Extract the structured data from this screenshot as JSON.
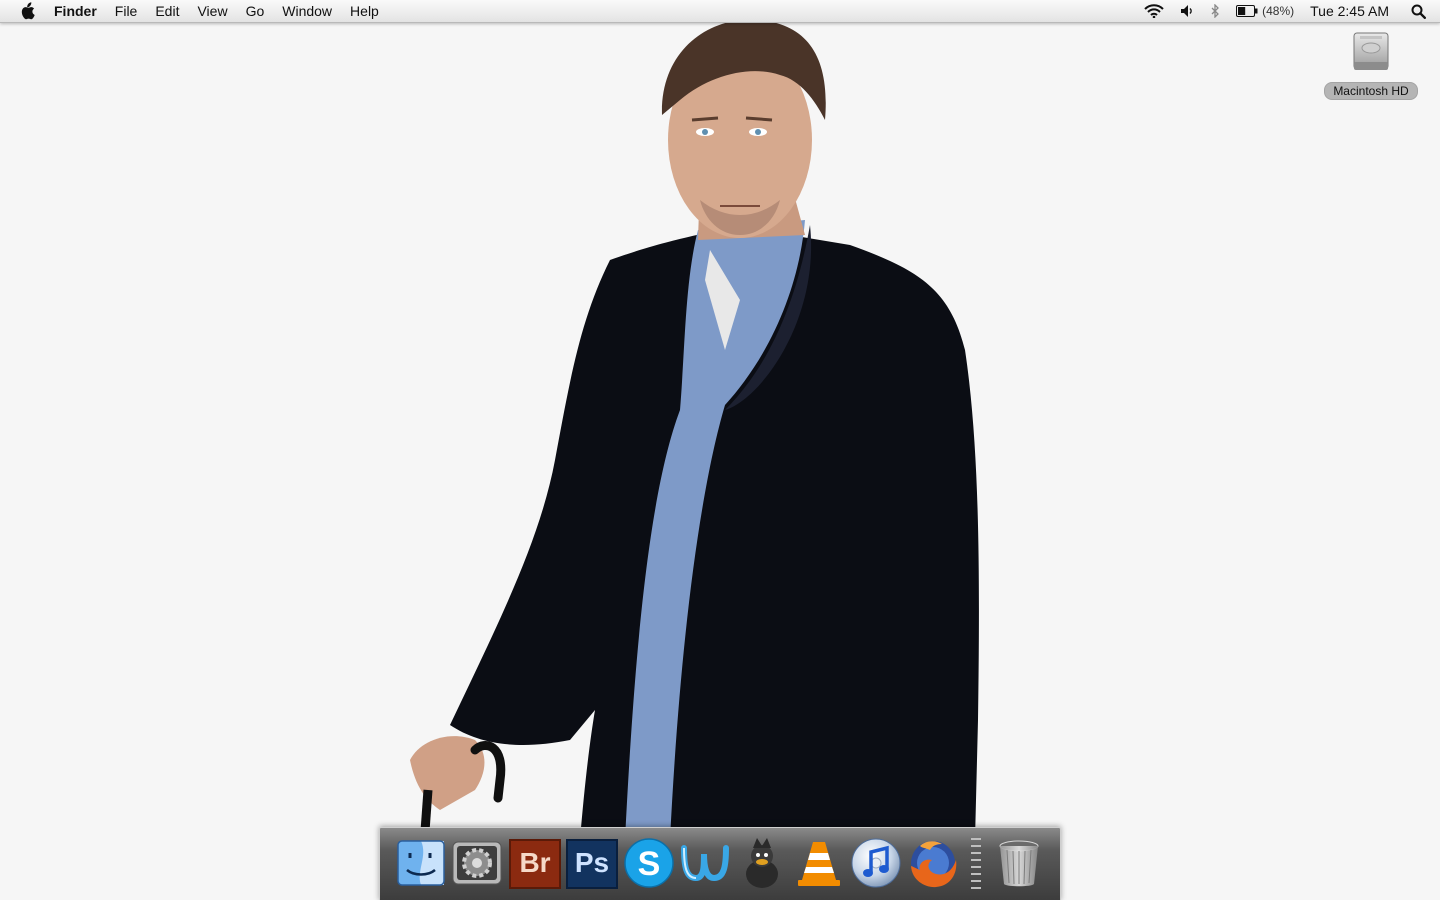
{
  "menubar": {
    "apple_icon": "apple-icon",
    "app_name": "Finder",
    "menus": [
      "File",
      "Edit",
      "View",
      "Go",
      "Window",
      "Help"
    ],
    "status": {
      "wifi_icon": "wifi-icon",
      "volume_icon": "volume-icon",
      "bluetooth_icon": "bluetooth-icon",
      "battery_icon": "battery-icon",
      "battery_percent": "(48%)",
      "battery_level": 0.48,
      "clock": "Tue 2:45 AM",
      "spotlight_icon": "spotlight-search-icon"
    }
  },
  "desktop": {
    "icons": [
      {
        "label": "Macintosh HD",
        "icon": "hard-drive-icon"
      }
    ]
  },
  "dock": {
    "items": [
      {
        "name": "Finder",
        "icon": "finder-icon"
      },
      {
        "name": "System Preferences",
        "icon": "system-preferences-icon"
      },
      {
        "name": "Adobe Bridge",
        "icon": "adobe-bridge-icon",
        "tile_text": "Br"
      },
      {
        "name": "Adobe Photoshop",
        "icon": "adobe-photoshop-icon",
        "tile_text": "Ps"
      },
      {
        "name": "Skype",
        "icon": "skype-icon"
      },
      {
        "name": "Windows Live Writer",
        "icon": "windows-live-icon"
      },
      {
        "name": "Adium",
        "icon": "adium-icon"
      },
      {
        "name": "VLC",
        "icon": "vlc-icon"
      },
      {
        "name": "iTunes",
        "icon": "itunes-icon"
      },
      {
        "name": "Firefox",
        "icon": "firefox-icon"
      },
      {
        "name": "Trash",
        "icon": "trash-icon"
      }
    ]
  },
  "colors": {
    "desktop_background": "#f6f6f6",
    "bridge_tile": "#8b2a10",
    "photoshop_tile": "#12335f",
    "skype_blue": "#1aa3e8"
  }
}
